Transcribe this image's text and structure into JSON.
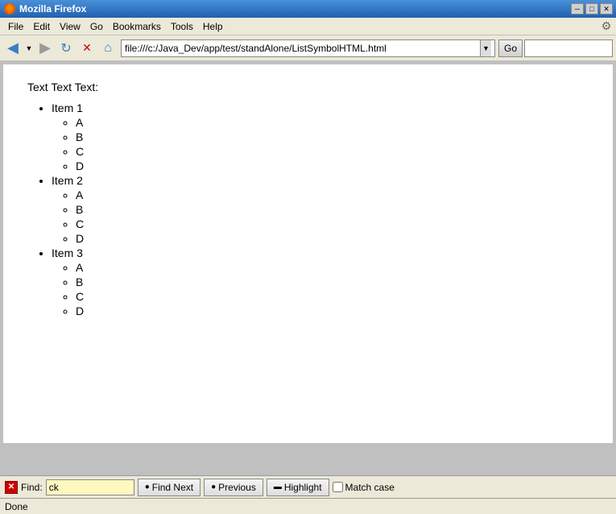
{
  "titlebar": {
    "title": "Mozilla Firefox",
    "buttons": {
      "minimize": "─",
      "restore": "□",
      "close": "✕"
    }
  },
  "menubar": {
    "items": [
      {
        "label": "File",
        "id": "file"
      },
      {
        "label": "Edit",
        "id": "edit"
      },
      {
        "label": "View",
        "id": "view"
      },
      {
        "label": "Go",
        "id": "go"
      },
      {
        "label": "Bookmarks",
        "id": "bookmarks"
      },
      {
        "label": "Tools",
        "id": "tools"
      },
      {
        "label": "Help",
        "id": "help"
      }
    ]
  },
  "toolbar": {
    "back_label": "◄",
    "forward_label": "►",
    "reload_label": "↻",
    "stop_label": "✕",
    "home_label": "⌂",
    "go_label": "Go",
    "address": "file:///c:/Java_Dev/app/test/standAlone/ListSymbolHTML.html"
  },
  "content": {
    "intro_text": "Text Text Text:",
    "items": [
      {
        "label": "Item 1",
        "subitems": [
          "A",
          "B",
          "C",
          "D"
        ]
      },
      {
        "label": "Item 2",
        "subitems": [
          "A",
          "B",
          "C",
          "D"
        ]
      },
      {
        "label": "Item 3",
        "subitems": [
          "A",
          "B",
          "C",
          "D"
        ]
      }
    ]
  },
  "findbar": {
    "close_label": "✕",
    "find_label": "Find:",
    "find_value": "ck",
    "find_next_label": "Find Next",
    "previous_label": "Previous",
    "highlight_label": "Highlight",
    "match_case_label": "Match case",
    "match_case_checked": false
  },
  "statusbar": {
    "text": "Done"
  }
}
